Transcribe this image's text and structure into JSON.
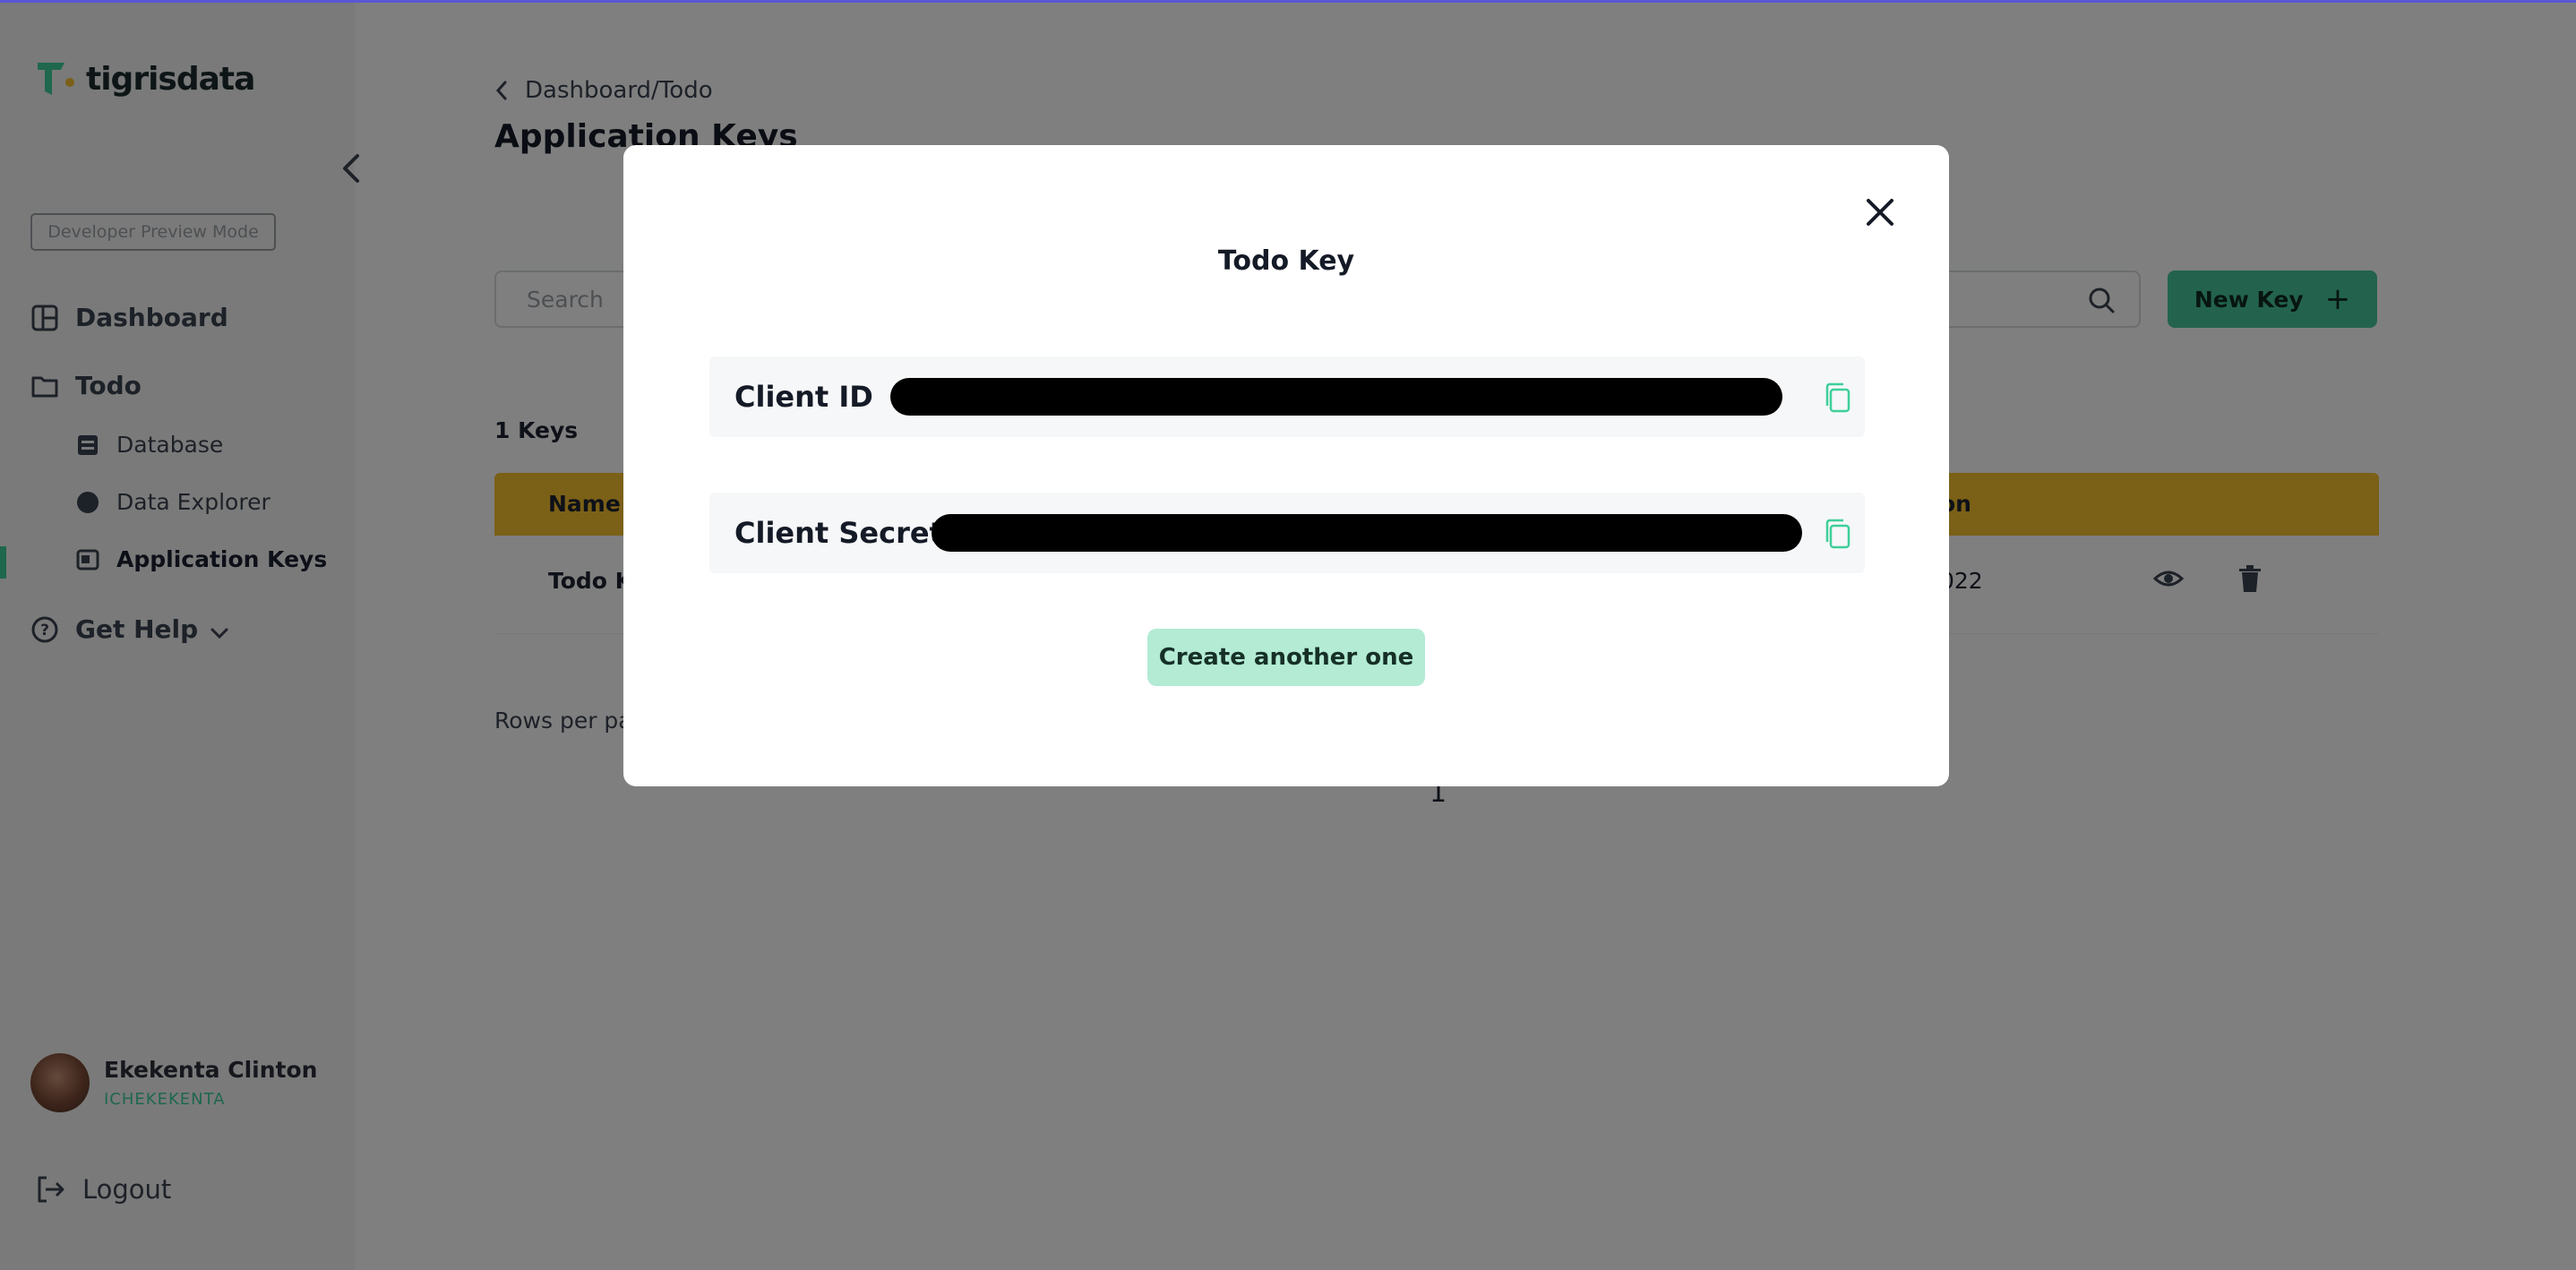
{
  "app": {
    "logo_text": "tigrisdata",
    "mode_chip": "Developer Preview Mode"
  },
  "sidebar": {
    "items": [
      {
        "label": "Dashboard",
        "icon": "grid-icon"
      },
      {
        "label": "Todo",
        "icon": "folder-icon"
      }
    ],
    "sub_items": [
      {
        "label": "Database",
        "icon": "database-icon"
      },
      {
        "label": "Data Explorer",
        "icon": "globe-icon"
      },
      {
        "label": "Application Keys",
        "icon": "key-card-icon",
        "active": true
      }
    ],
    "help": {
      "label": "Get Help",
      "icon": "help-circle-icon"
    },
    "user": {
      "name": "Ekekenta Clinton",
      "handle": "ICHEKEKENTA"
    },
    "logout": {
      "label": "Logout",
      "icon": "logout-icon"
    }
  },
  "main": {
    "breadcrumb": "Dashboard/Todo",
    "title": "Application Keys",
    "search_placeholder": "Search",
    "new_key_label": "New Key",
    "keys_count": "1 Keys",
    "table": {
      "headers": [
        "Name",
        "on"
      ],
      "rows": [
        {
          "name": "Todo K",
          "date_fragment": "022"
        }
      ]
    },
    "rows_per_page": "Rows per pa",
    "page_number": "1"
  },
  "modal": {
    "title": "Todo Key",
    "client_id_label": "Client ID",
    "client_secret_label": "Client Secret",
    "create_button": "Create another one"
  },
  "colors": {
    "accent": "#3ecf9a",
    "table_header": "#f6c02e",
    "primary_button": "#46c79b",
    "secondary_button": "#b3ebd4"
  }
}
